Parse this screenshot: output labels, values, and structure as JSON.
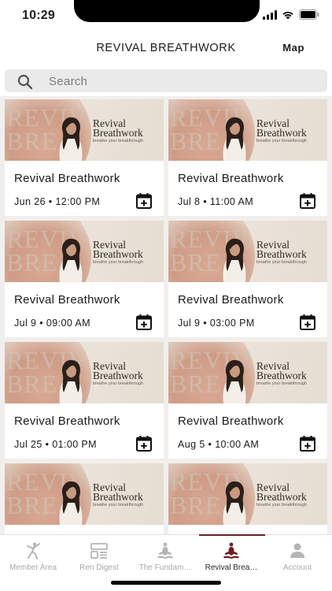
{
  "status_bar": {
    "time": "10:29"
  },
  "header": {
    "title": "REVIVAL BREATHWORK",
    "map_label": "Map"
  },
  "search": {
    "placeholder": "Search"
  },
  "colors": {
    "accent": "#6b1e24",
    "inactive": "#a9a9a9",
    "background": "#f1efed"
  },
  "banner": {
    "title_line1": "Revival",
    "title_line2": "Breathwork",
    "tagline": "breathe your breakthrough",
    "watermark_line1": "REVIV",
    "watermark_line2": "BRE"
  },
  "events": [
    {
      "title": "Revival Breathwork",
      "date": "Jun 26 • 12:00 PM"
    },
    {
      "title": "Revival Breathwork",
      "date": "Jul 8 • 11:00 AM"
    },
    {
      "title": "Revival Breathwork",
      "date": "Jul 9 • 09:00 AM"
    },
    {
      "title": "Revival Breathwork",
      "date": "Jul 9 • 03:00 PM"
    },
    {
      "title": "Revival Breathwork",
      "date": "Jul 25 • 01:00 PM"
    },
    {
      "title": "Revival Breathwork",
      "date": "Aug 5 • 10:00 AM"
    },
    {
      "title": "",
      "date": ""
    },
    {
      "title": "",
      "date": ""
    }
  ],
  "tabs": [
    {
      "label": "Member Area",
      "icon": "yoga-pose-icon",
      "active": false
    },
    {
      "label": "Ren Digest",
      "icon": "digest-layout-icon",
      "active": false
    },
    {
      "label": "The Fundam…",
      "icon": "meditation-icon",
      "active": false
    },
    {
      "label": "Revival Brea…",
      "icon": "meditation-icon",
      "active": true
    },
    {
      "label": "Account",
      "icon": "person-icon",
      "active": false
    }
  ]
}
